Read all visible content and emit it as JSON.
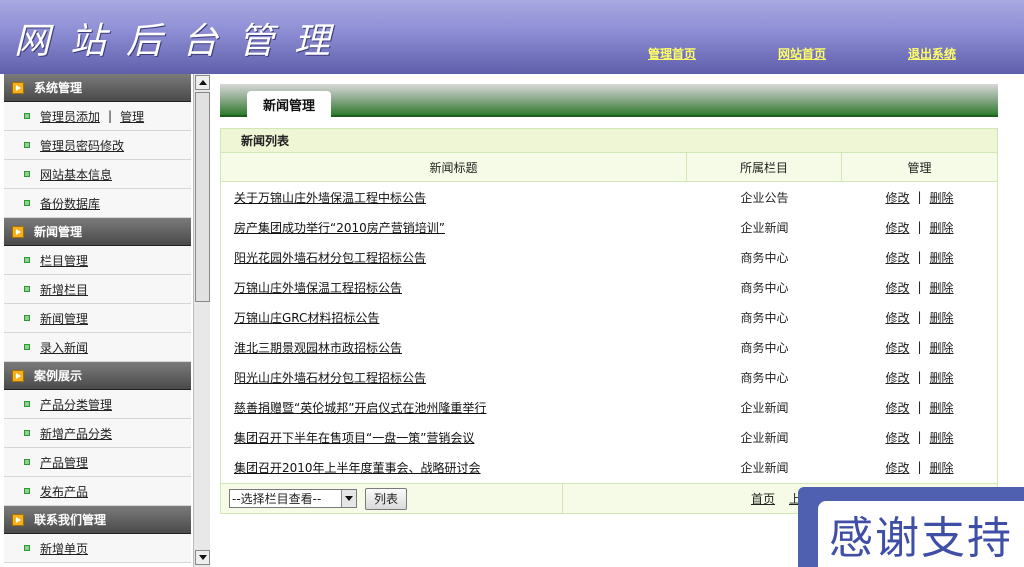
{
  "header": {
    "logo_text": "网站后台管理",
    "nav": [
      "管理首页",
      "网站首页",
      "退出系统"
    ]
  },
  "sidebar": {
    "sections": [
      {
        "title": "系统管理",
        "items": [
          {
            "label": "管理员添加",
            "extra": "管理"
          },
          {
            "label": "管理员密码修改"
          },
          {
            "label": "网站基本信息"
          },
          {
            "label": "备份数据库"
          }
        ]
      },
      {
        "title": "新闻管理",
        "items": [
          {
            "label": "栏目管理"
          },
          {
            "label": "新增栏目"
          },
          {
            "label": "新闻管理"
          },
          {
            "label": "录入新闻"
          }
        ]
      },
      {
        "title": "案例展示",
        "items": [
          {
            "label": "产品分类管理"
          },
          {
            "label": "新增产品分类"
          },
          {
            "label": "产品管理"
          },
          {
            "label": "发布产品"
          }
        ]
      },
      {
        "title": "联系我们管理",
        "items": [
          {
            "label": "新增单页"
          }
        ]
      }
    ],
    "separator": "|"
  },
  "tab": {
    "label": "新闻管理"
  },
  "panel": {
    "title": "新闻列表",
    "columns": [
      "新闻标题",
      "所属栏目",
      "管理"
    ],
    "edit_label": "修改",
    "delete_label": "删除",
    "action_separator": "|",
    "rows": [
      {
        "title": "关于万锦山庄外墙保温工程中标公告",
        "category": "企业公告"
      },
      {
        "title": "房产集团成功举行“2010房产营销培训”",
        "category": "企业新闻"
      },
      {
        "title": "阳光花园外墙石材分包工程招标公告",
        "category": "商务中心"
      },
      {
        "title": "万锦山庄外墙保温工程招标公告",
        "category": "商务中心"
      },
      {
        "title": "万锦山庄GRC材料招标公告",
        "category": "商务中心"
      },
      {
        "title": "淮北三期景观园林市政招标公告",
        "category": "商务中心"
      },
      {
        "title": "阳光山庄外墙石材分包工程招标公告",
        "category": "商务中心"
      },
      {
        "title": "慈善捐赠暨“英伦城邦”开启仪式在池州隆重举行",
        "category": "企业新闻"
      },
      {
        "title": "集团召开下半年在售项目“一盘一策”营销会议",
        "category": "企业新闻"
      },
      {
        "title": "集团召开2010年上半年度董事会、战略研讨会",
        "category": "企业新闻"
      }
    ],
    "select_value": "--选择栏目查看--",
    "list_button": "列表",
    "pager": [
      "首页",
      "上"
    ]
  },
  "badge": {
    "text": "感谢支持"
  }
}
